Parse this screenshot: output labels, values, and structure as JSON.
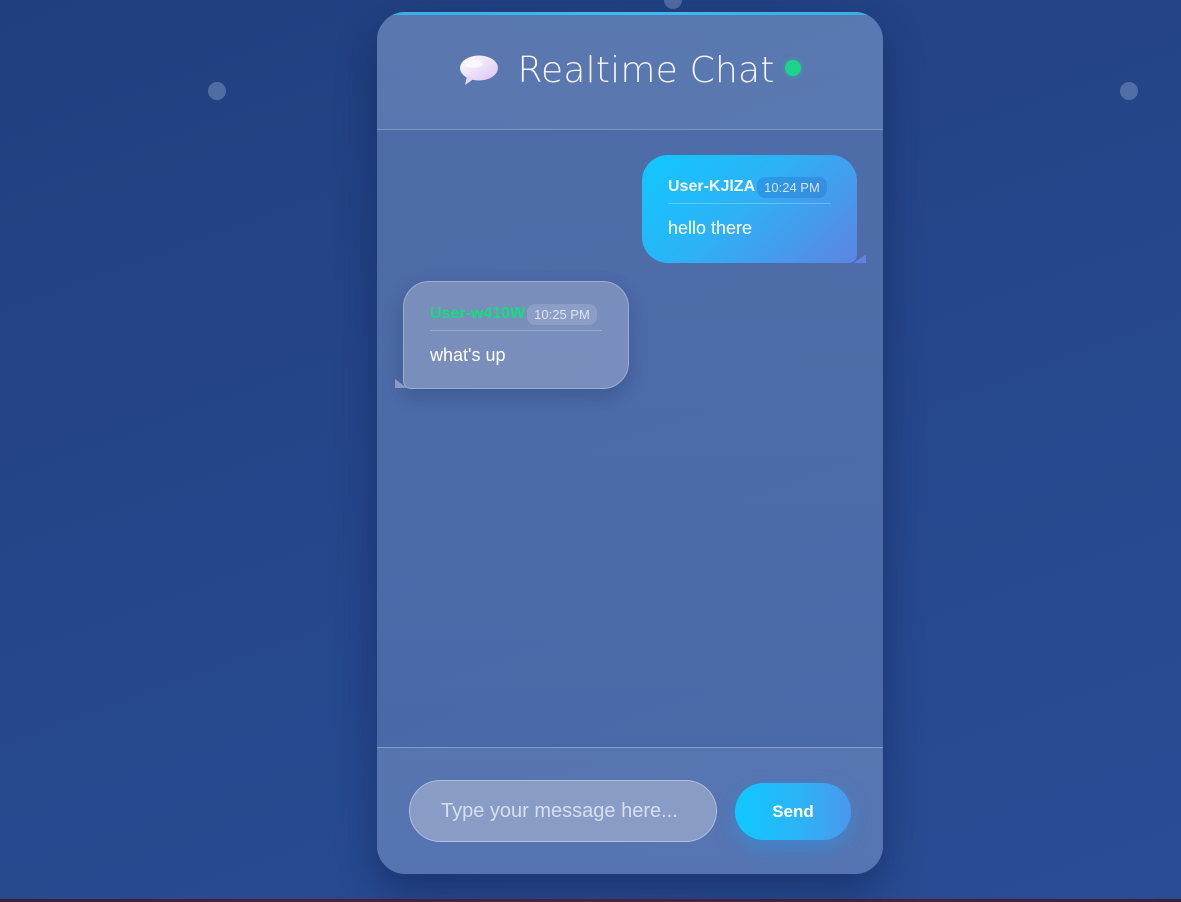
{
  "header": {
    "title": "Realtime Chat",
    "icon": "speech-bubble-icon",
    "status": "online",
    "status_color": "#1ed38c"
  },
  "messages": [
    {
      "username": "User-KJlZA",
      "time": "10:24 PM",
      "text": "hello there",
      "own": true
    },
    {
      "username": "User-w410W",
      "time": "10:25 PM",
      "text": "what's up",
      "own": false
    }
  ],
  "composer": {
    "placeholder": "Type your message here...",
    "value": "",
    "send_label": "Send"
  },
  "colors": {
    "accent": "#10c8ff",
    "other_username": "#12e07a",
    "background": "#25468a"
  }
}
